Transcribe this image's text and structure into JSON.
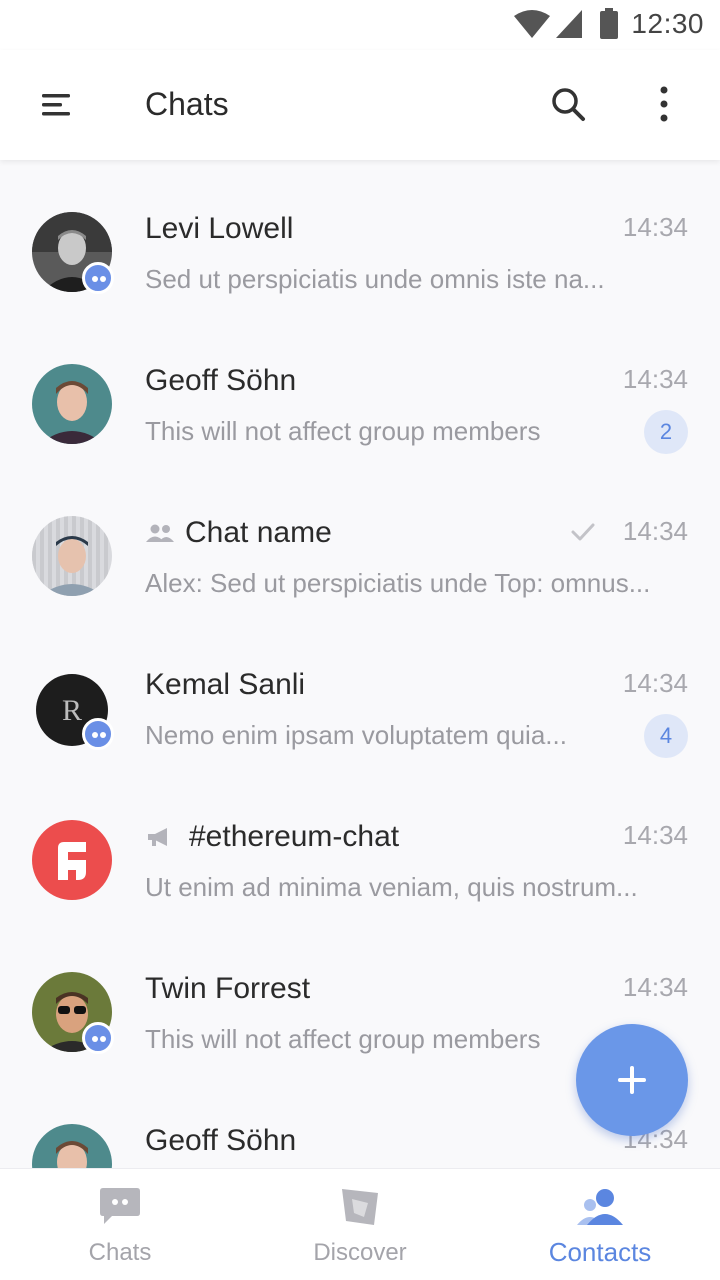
{
  "status": {
    "time": "12:30"
  },
  "toolbar": {
    "title": "Chats"
  },
  "chats": [
    {
      "name": "Levi Lowell",
      "time": "14:34",
      "preview": "Sed ut perspiciatis unde omnis iste na...",
      "unread": ""
    },
    {
      "name": "Geoff Söhn",
      "time": "14:34",
      "preview": "This will not affect group members",
      "unread": "2"
    },
    {
      "name": "Chat name",
      "time": "14:34",
      "preview": "Alex: Sed ut perspiciatis unde Top: omnus...",
      "unread": ""
    },
    {
      "name": "Kemal Sanli",
      "time": "14:34",
      "preview": "Nemo enim ipsam voluptatem quia...",
      "unread": "4"
    },
    {
      "name": "#ethereum-chat",
      "time": "14:34",
      "preview": "Ut enim ad minima veniam, quis nostrum...",
      "unread": ""
    },
    {
      "name": "Twin Forrest",
      "time": "14:34",
      "preview": "This will not affect group members",
      "unread": ""
    },
    {
      "name": "Geoff Söhn",
      "time": "14:34",
      "preview": "",
      "unread": ""
    }
  ],
  "nav": [
    {
      "label": "Chats"
    },
    {
      "label": "Discover"
    },
    {
      "label": "Contacts"
    }
  ],
  "colors": {
    "accent": "#6a97e8",
    "badge_bg": "#dfe7f8",
    "muted_text": "#9a9aa0"
  }
}
